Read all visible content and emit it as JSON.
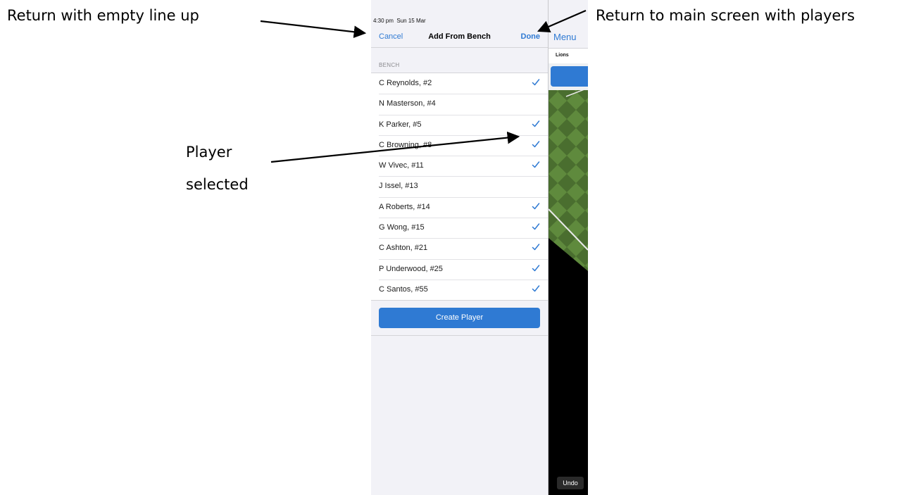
{
  "annotations": {
    "return_empty": "Return with empty line up",
    "return_main": "Return to main screen with players",
    "player_selected_line1": "Player",
    "player_selected_line2": "selected"
  },
  "status_bar": {
    "time": "4:30 pm",
    "date": "Sun 15 Mar"
  },
  "nav": {
    "cancel_label": "Cancel",
    "title": "Add From Bench",
    "done_label": "Done"
  },
  "bench": {
    "section_header": "BENCH",
    "players": [
      {
        "label": "C Reynolds, #2",
        "selected": true
      },
      {
        "label": "N Masterson, #4",
        "selected": false
      },
      {
        "label": "K Parker, #5",
        "selected": true
      },
      {
        "label": "C Browning, #8",
        "selected": true
      },
      {
        "label": "W Vivec, #11",
        "selected": true
      },
      {
        "label": "J Issel, #13",
        "selected": false
      },
      {
        "label": "A Roberts, #14",
        "selected": true
      },
      {
        "label": "G Wong, #15",
        "selected": true
      },
      {
        "label": "C Ashton, #21",
        "selected": true
      },
      {
        "label": "P Underwood, #25",
        "selected": true
      },
      {
        "label": "C Santos, #55",
        "selected": true
      }
    ],
    "create_label": "Create Player"
  },
  "main": {
    "menu_label": "Menu",
    "team_name": "Lions",
    "undo_label": "Undo"
  },
  "colors": {
    "accent": "#2f7ad3",
    "field_green_dark": "#4a6e2f",
    "field_green_light": "#5f8a3d",
    "panel_bg": "#f2f2f7"
  },
  "icons": {
    "checkmark": "checkmark-icon",
    "arrow": "arrow-icon"
  }
}
